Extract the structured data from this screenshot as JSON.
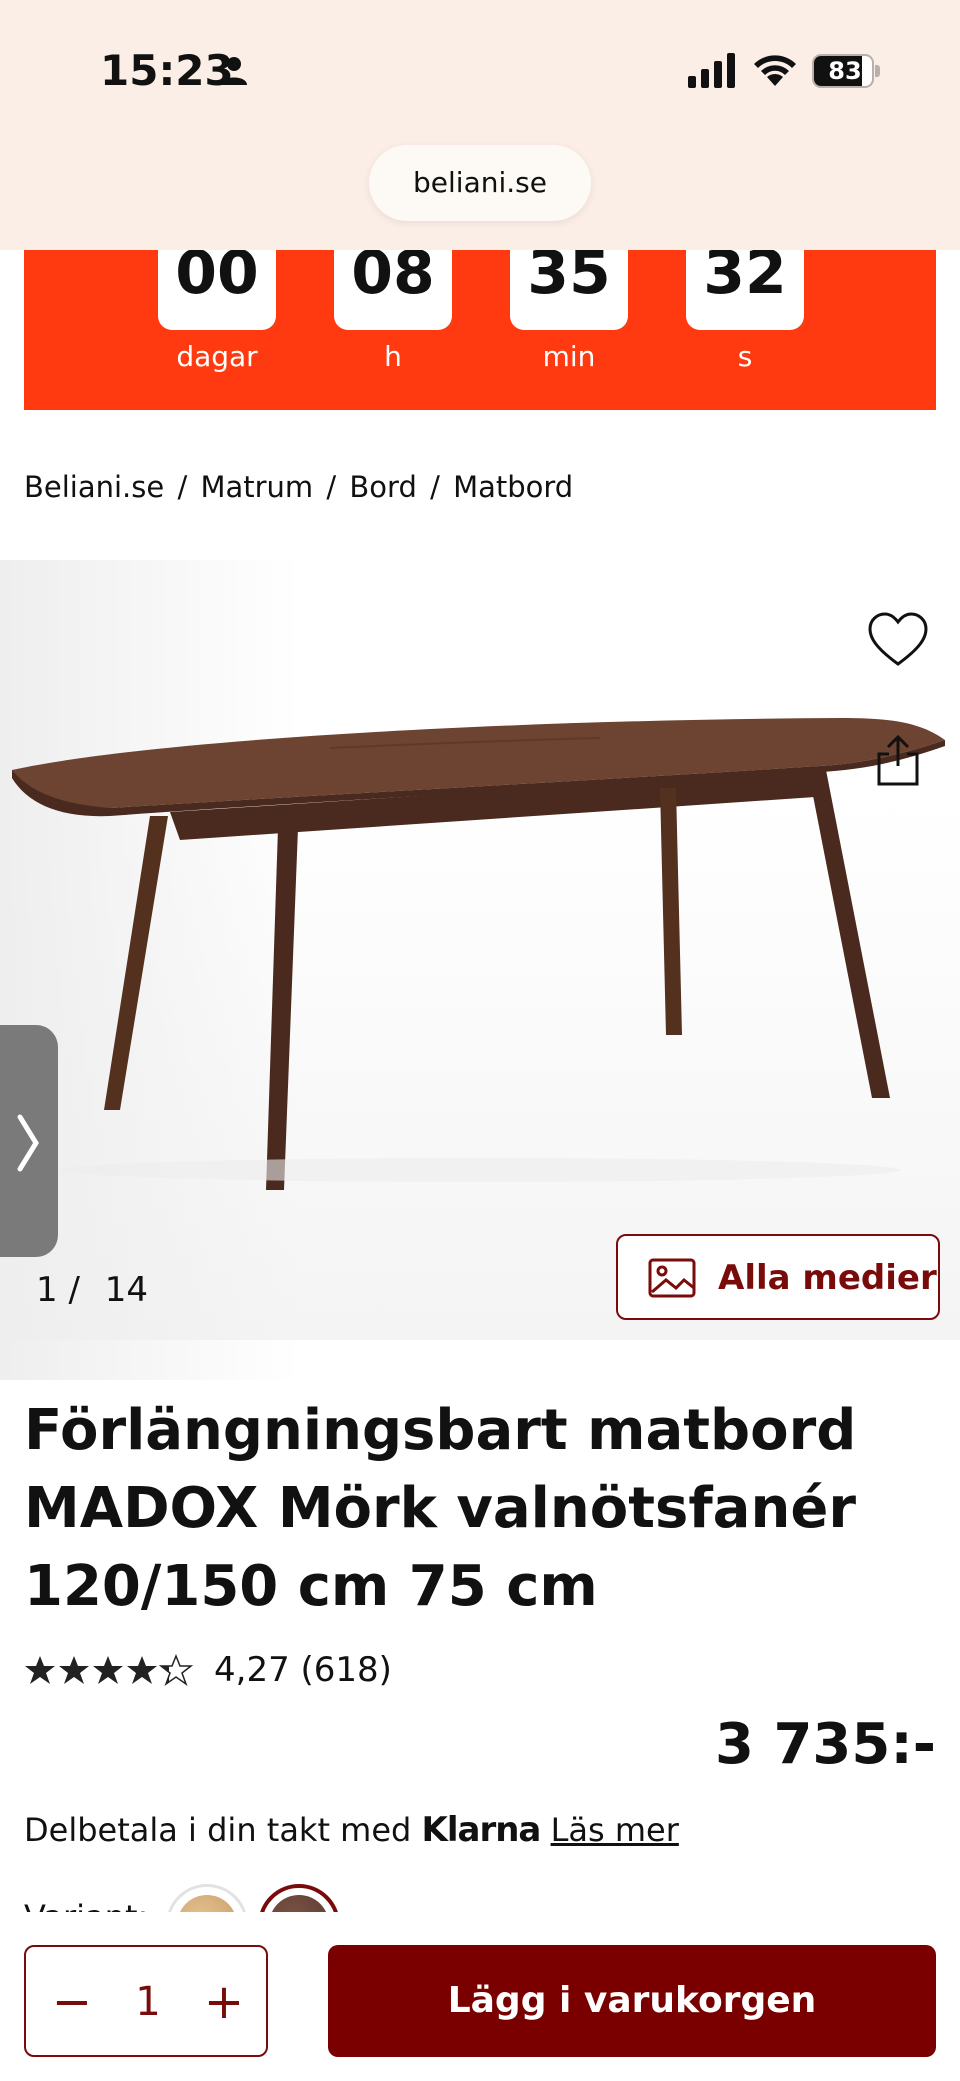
{
  "status_bar": {
    "time": "15:23",
    "battery": "83",
    "battery_level": 0.83
  },
  "browser": {
    "url": "beliani.se"
  },
  "countdown": {
    "items": [
      {
        "value": "00",
        "label": "dagar"
      },
      {
        "value": "08",
        "label": "h"
      },
      {
        "value": "35",
        "label": "min"
      },
      {
        "value": "32",
        "label": "s"
      }
    ],
    "color": "#ff3a10"
  },
  "breadcrumb": {
    "items": [
      "Beliani.se",
      "Matrum",
      "Bord",
      "Matbord"
    ],
    "separator": "/"
  },
  "gallery": {
    "current": "1",
    "separator": "/",
    "total": "14",
    "media_button": "Alla medier"
  },
  "product": {
    "title": "Förlängningsbart matbord MADOX Mörk valnötsfanér 120/150 cm 75 cm",
    "rating_value": 4.27,
    "rating_text": "4,27 (618)",
    "price": "3 735:-",
    "klarna_prefix": "Delbetala i din takt med",
    "klarna_brand": "Klarna",
    "klarna_link": "Läs mer",
    "variant_label": "Variant:"
  },
  "cart": {
    "minus": "−",
    "quantity": "1",
    "plus": "+",
    "add_label": "Lägg i varukorgen",
    "accent": "#7a0000"
  }
}
